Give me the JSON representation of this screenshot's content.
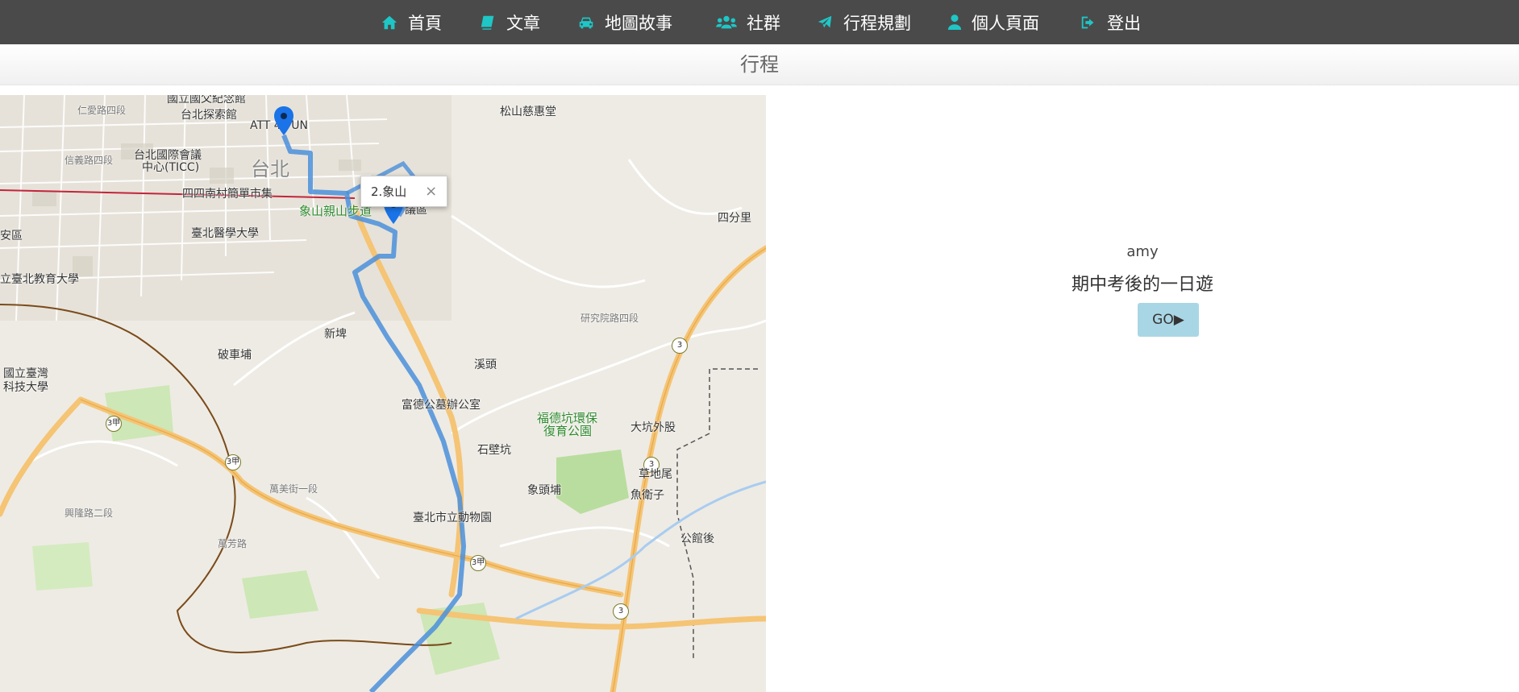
{
  "nav": {
    "items": [
      {
        "label": "首頁",
        "icon": "home-icon"
      },
      {
        "label": "文章",
        "icon": "book-icon"
      },
      {
        "label": "地圖故事",
        "icon": "car-icon"
      },
      {
        "label": "社群",
        "icon": "users-icon"
      },
      {
        "label": "行程規劃",
        "icon": "plane-icon"
      },
      {
        "label": "個人頁面",
        "icon": "user-icon"
      },
      {
        "label": "登出",
        "icon": "sign-out-icon"
      }
    ],
    "icon_color": "#1fc6c6"
  },
  "subheader": {
    "title": "行程"
  },
  "map": {
    "labels": {
      "l1": "國立國父紀念館",
      "l2": "台北探索館",
      "l3": "ATT 4 FUN",
      "l4": "台北國際會議",
      "l5": "中心(TICC)",
      "l6": "台北",
      "l7": "四四南村簡單市集",
      "l8": "象山親山步道",
      "l9": "臺北醫學大學",
      "l10": "立臺北教育大學",
      "l11": "國立臺灣",
      "l12": "科技大學",
      "l13": "松山慈惠堂",
      "l14": "四分里",
      "l15": "富德公墓辦公室",
      "l16": "福德坑環保",
      "l17": "復育公園",
      "l18": "大坑外股",
      "l19": "石壁坑",
      "l20": "草地尾",
      "l21": "魚衛子",
      "l22": "象頭埔",
      "l23": "臺北市立動物園",
      "l24": "公館後",
      "l25": "溪頭",
      "l26": "新埤",
      "l27": "破車埔",
      "l28": "萬美街一段",
      "l29": "仁愛路四段",
      "l30": "信義路四段",
      "l31": "研究院路四段",
      "l32": "興隆路二段",
      "l33": "議區",
      "l34": "安區",
      "l35": "萬芳路"
    },
    "infowindow": {
      "label": "2.象山",
      "close": "×"
    }
  },
  "trip": {
    "user": "amy",
    "title": "期中考後的一日遊",
    "go_label": "GO▶"
  }
}
